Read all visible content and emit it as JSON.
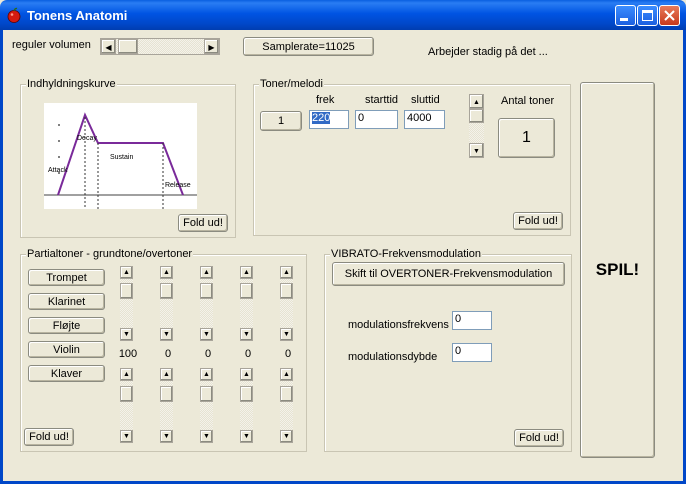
{
  "window": {
    "title": "Tonens Anatomi"
  },
  "volume": {
    "label": "reguler volumen"
  },
  "samplerate_button": "Samplerate=11025",
  "status_text": "Arbejder stadig på det ...",
  "envelope": {
    "group_label": "Indhyldningskurve",
    "stage_labels": [
      "Attack",
      "Decay",
      "Sustain",
      "Release"
    ],
    "fold_button": "Fold ud!"
  },
  "tones": {
    "group_label": "Toner/melodi",
    "col_freq": "frek",
    "col_start": "starttid",
    "col_end": "sluttid",
    "row_index": "1",
    "freq_value": "220",
    "start_value": "0",
    "end_value": "4000",
    "count_label": "Antal toner",
    "count_value": "1",
    "fold_button": "Fold ud!"
  },
  "partials": {
    "group_label": "Partialtoner - grundtone/overtoner",
    "instruments": [
      "Trompet",
      "Klarinet",
      "Fløjte",
      "Violin",
      "Klaver"
    ],
    "values": [
      "100",
      "0",
      "0",
      "0",
      "0"
    ],
    "fold_button": "Fold ud!"
  },
  "vibrato": {
    "group_label": "VIBRATO-Frekvensmodulation",
    "switch_button": "Skift til OVERTONER-Frekvensmodulation",
    "freq_label": "modulationsfrekvens",
    "freq_value": "0",
    "depth_label": "modulationsdybde",
    "depth_value": "0",
    "fold_button": "Fold ud!"
  },
  "play_button": "SPIL!"
}
